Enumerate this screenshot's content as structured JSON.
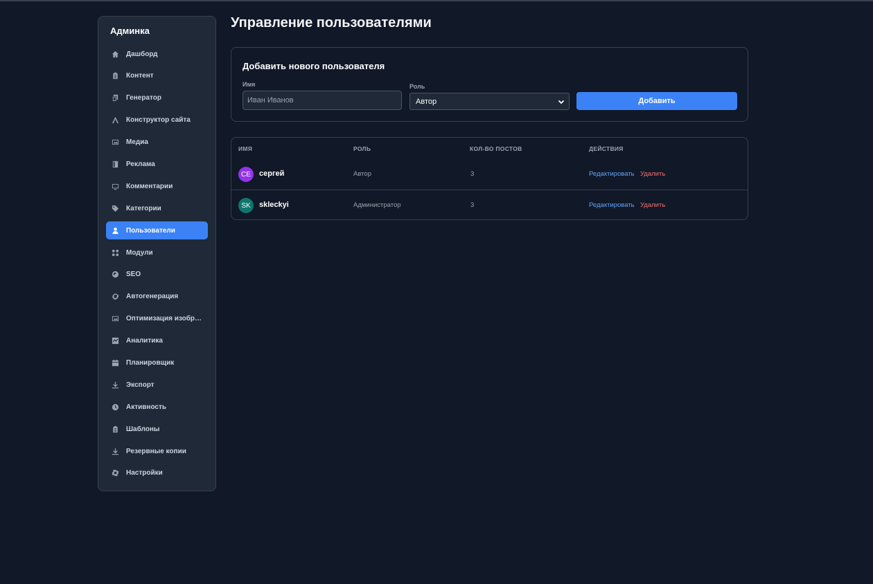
{
  "sidebar": {
    "title": "Админка",
    "items": [
      {
        "label": "Дашборд",
        "icon": "home-icon"
      },
      {
        "label": "Контент",
        "icon": "clipboard-icon"
      },
      {
        "label": "Генератор",
        "icon": "copy-icon"
      },
      {
        "label": "Конструктор сайта",
        "icon": "a-letter-icon"
      },
      {
        "label": "Медиа",
        "icon": "image-icon"
      },
      {
        "label": "Реклама",
        "icon": "book-icon"
      },
      {
        "label": "Комментарии",
        "icon": "monitor-icon"
      },
      {
        "label": "Категории",
        "icon": "tag-icon"
      },
      {
        "label": "Пользователи",
        "icon": "user-icon",
        "active": true
      },
      {
        "label": "Модули",
        "icon": "grid-icon"
      },
      {
        "label": "SEO",
        "icon": "gauge-icon"
      },
      {
        "label": "Автогенерация",
        "icon": "refresh-icon"
      },
      {
        "label": "Оптимизация изображений",
        "icon": "image-icon"
      },
      {
        "label": "Аналитика",
        "icon": "chart-icon"
      },
      {
        "label": "Планировщик",
        "icon": "calendar-icon"
      },
      {
        "label": "Экспорт",
        "icon": "download-icon"
      },
      {
        "label": "Активность",
        "icon": "clock-icon"
      },
      {
        "label": "Шаблоны",
        "icon": "clipboard-icon"
      },
      {
        "label": "Резервные копии",
        "icon": "download-icon"
      },
      {
        "label": "Настройки",
        "icon": "gear-icon"
      }
    ]
  },
  "main": {
    "title": "Управление пользователями",
    "add_form": {
      "title": "Добавить нового пользователя",
      "name_label": "Имя",
      "name_placeholder": "Иван Иванов",
      "role_label": "Роль",
      "role_value": "Автор",
      "submit_label": "Добавить"
    },
    "table": {
      "headers": [
        "Имя",
        "Роль",
        "Кол-во постов",
        "Действия"
      ],
      "rows": [
        {
          "initials": "СЕ",
          "name": "сергей",
          "role": "Автор",
          "posts": "3",
          "edit": "Редактировать",
          "delete": "Удалить",
          "avatar_color": "#9333ea"
        },
        {
          "initials": "SK",
          "name": "skleckyi",
          "role": "Администратор",
          "posts": "3",
          "edit": "Редактировать",
          "delete": "Удалить",
          "avatar_color": "#0f766e"
        }
      ]
    }
  },
  "colors": {
    "accent": "#3b82f6",
    "danger": "#f87171",
    "link": "#60a5fa"
  }
}
